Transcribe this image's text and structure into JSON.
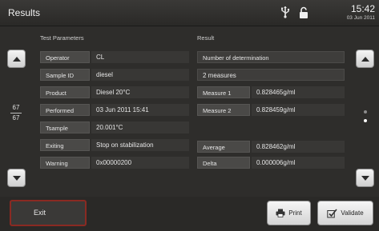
{
  "header": {
    "title": "Results",
    "time": "15:42",
    "date": "03 Jun 2011"
  },
  "left_section_title": "Test Parameters",
  "right_section_title": "Result",
  "parameters": [
    {
      "label": "Operator",
      "value": "CL"
    },
    {
      "label": "Sample ID",
      "value": "diesel"
    },
    {
      "label": "Product",
      "value": "Diesel 20°C"
    },
    {
      "label": "Performed",
      "value": "03 Jun 2011 15:41"
    },
    {
      "label": "Tsample",
      "value": "20.001°C"
    },
    {
      "label": "Exiting",
      "value": "Stop on stabilization"
    },
    {
      "label": "Warning",
      "value": "0x00000200"
    }
  ],
  "result": {
    "determination_label": "Number of determination",
    "determination_value": "2 measures",
    "measure1_label": "Measure 1",
    "measure1_value": "0.828465g/ml",
    "measure2_label": "Measure 2",
    "measure2_value": "0.828459g/ml",
    "average_label": "Average",
    "average_value": "0.828462g/ml",
    "delta_label": "Delta",
    "delta_value": "0.000006g/ml"
  },
  "pagination": {
    "current": "67",
    "total": "67"
  },
  "buttons": {
    "exit": "Exit",
    "print": "Print",
    "validate": "Validate"
  },
  "colors": {
    "accent_exit_border": "#8a2a22",
    "active_dot": "#ffffff",
    "inactive_dot": "#8c8c8c"
  },
  "icons": {
    "usb": "usb-icon",
    "lock": "lock-icon",
    "print": "printer-icon",
    "validate": "checkmark-icon"
  }
}
